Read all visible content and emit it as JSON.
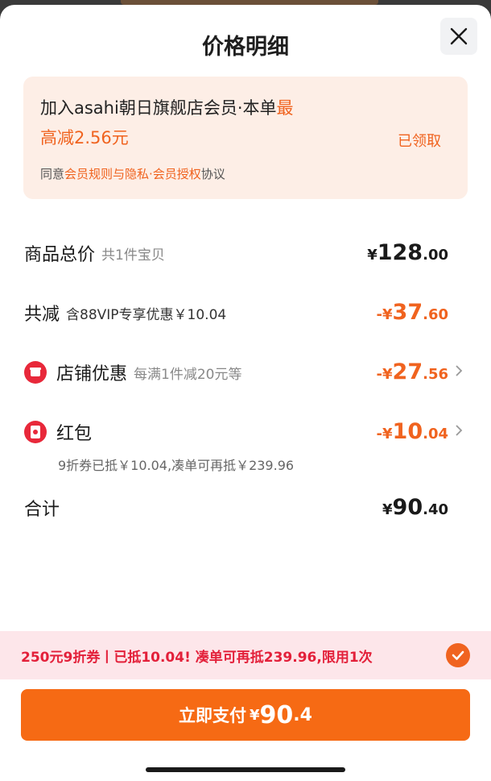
{
  "header": {
    "title": "价格明细"
  },
  "member": {
    "line1_text": "加入asahi朝日旗舰店会员·本单",
    "line1_highlight": "最",
    "line2": "高减2.56元",
    "status": "已领取",
    "agree_prefix": "同意",
    "agree_link": "会员规则与隐私·会员授权",
    "agree_suffix": "协议"
  },
  "rows": {
    "total": {
      "label": "商品总价",
      "sub": "共1件宝贝",
      "cur": "¥",
      "int": "128",
      "dec": ".00"
    },
    "reduce": {
      "label": "共减",
      "sub": "含88VIP专享优惠￥10.04",
      "cur": "-¥",
      "int": "37",
      "dec": ".60"
    },
    "store": {
      "label": "店铺优惠",
      "sub": "每满1件减20元等",
      "cur": "-¥",
      "int": "27",
      "dec": ".56"
    },
    "redpack": {
      "label": "红包",
      "note": "9折券已抵￥10.04,凑单可再抵￥239.96",
      "cur": "-¥",
      "int": "10",
      "dec": ".04"
    },
    "sum": {
      "label": "合计",
      "cur": "¥",
      "int": "90",
      "dec": ".40"
    }
  },
  "promo": {
    "text": "250元9折券丨已抵10.04! 凑单可再抵239.96,限用1次"
  },
  "pay": {
    "label": "立即支付",
    "cur": "¥",
    "int": "90",
    "dec": ".4"
  },
  "colors": {
    "accent": "#f0631f",
    "red": "#e3203a",
    "button": "#f66a14"
  }
}
